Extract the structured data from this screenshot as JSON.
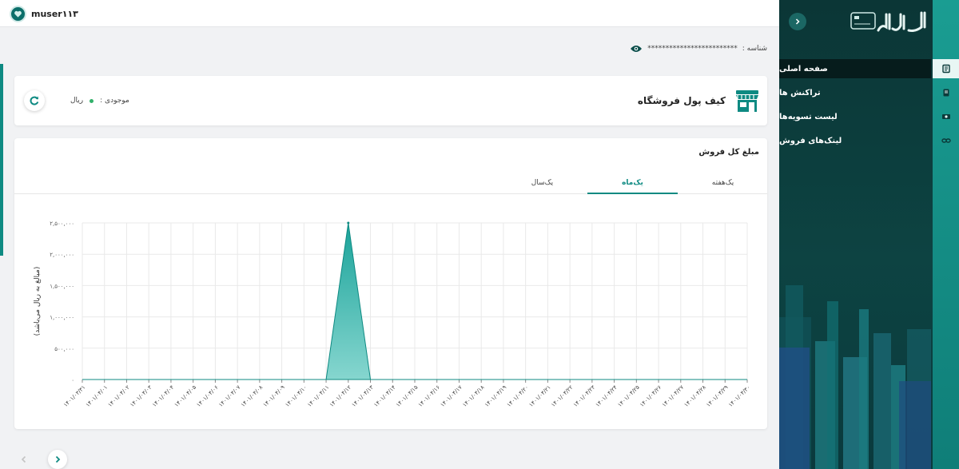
{
  "user": {
    "name": "muser۱۱۳"
  },
  "id_row": {
    "label": "شناسه :",
    "value": "*************************"
  },
  "wallet": {
    "title": "کیف پول فروشگاه",
    "balance_label": "موجودی :",
    "currency": "ریال"
  },
  "sales": {
    "title": "مبلغ کل فروش",
    "tabs": [
      {
        "label": "یک‌هفته",
        "active": false
      },
      {
        "label": "یک‌ماه",
        "active": true
      },
      {
        "label": "یک‌سال",
        "active": false
      }
    ]
  },
  "chart_data": {
    "type": "area",
    "ylabel": "(مبالغ به ریال می‌باشد)",
    "ylim": [
      0,
      2500000
    ],
    "y_ticks": [
      {
        "value": 0,
        "label": "۰"
      },
      {
        "value": 500000,
        "label": "۵۰۰,۰۰۰"
      },
      {
        "value": 1000000,
        "label": "۱,۰۰۰,۰۰۰"
      },
      {
        "value": 1500000,
        "label": "۱,۵۰۰,۰۰۰"
      },
      {
        "value": 2000000,
        "label": "۲,۰۰۰,۰۰۰"
      },
      {
        "value": 2500000,
        "label": "۲,۵۰۰,۰۰۰"
      }
    ],
    "categories": [
      "۱۴۰۱/۰۳/۳۱",
      "۱۴۰۱/۰۴/۰۱",
      "۱۴۰۱/۰۴/۰۲",
      "۱۴۰۱/۰۴/۰۳",
      "۱۴۰۱/۰۴/۰۴",
      "۱۴۰۱/۰۴/۰۵",
      "۱۴۰۱/۰۴/۰۶",
      "۱۴۰۱/۰۴/۰۷",
      "۱۴۰۱/۰۴/۰۸",
      "۱۴۰۱/۰۴/۰۹",
      "۱۴۰۱/۰۴/۱۰",
      "۱۴۰۱/۰۴/۱۱",
      "۱۴۰۱/۰۴/۱۲",
      "۱۴۰۱/۰۴/۱۳",
      "۱۴۰۱/۰۴/۱۴",
      "۱۴۰۱/۰۴/۱۵",
      "۱۴۰۱/۰۴/۱۶",
      "۱۴۰۱/۰۴/۱۷",
      "۱۴۰۱/۰۴/۱۸",
      "۱۴۰۱/۰۴/۱۹",
      "۱۴۰۱/۰۴/۲۰",
      "۱۴۰۱/۰۴/۲۱",
      "۱۴۰۱/۰۴/۲۲",
      "۱۴۰۱/۰۴/۲۳",
      "۱۴۰۱/۰۴/۲۴",
      "۱۴۰۱/۰۴/۲۵",
      "۱۴۰۱/۰۴/۲۶",
      "۱۴۰۱/۰۴/۲۷",
      "۱۴۰۱/۰۴/۲۸",
      "۱۴۰۱/۰۴/۲۹",
      "۱۴۰۱/۰۴/۳۰"
    ],
    "values": [
      0,
      0,
      0,
      0,
      0,
      0,
      0,
      0,
      0,
      0,
      0,
      0,
      2500000,
      0,
      0,
      0,
      0,
      0,
      0,
      0,
      0,
      0,
      0,
      0,
      0,
      0,
      0,
      0,
      0,
      0,
      0
    ],
    "grid": true,
    "color": "#0e8a82"
  },
  "nav": {
    "items": [
      {
        "label": "صفحه اصلی",
        "icon": "home-doc-icon",
        "active": true
      },
      {
        "label": "تراکنش ها",
        "icon": "receipt-icon",
        "active": false
      },
      {
        "label": "لیست تسویه‌ها",
        "icon": "cash-icon",
        "active": false
      },
      {
        "label": "لینک‌های فروش",
        "icon": "link-icon",
        "active": false
      }
    ]
  },
  "colors": {
    "primary": "#0e8a82",
    "sidebar": "#0b3a3a",
    "strip": "#1a9d92"
  }
}
